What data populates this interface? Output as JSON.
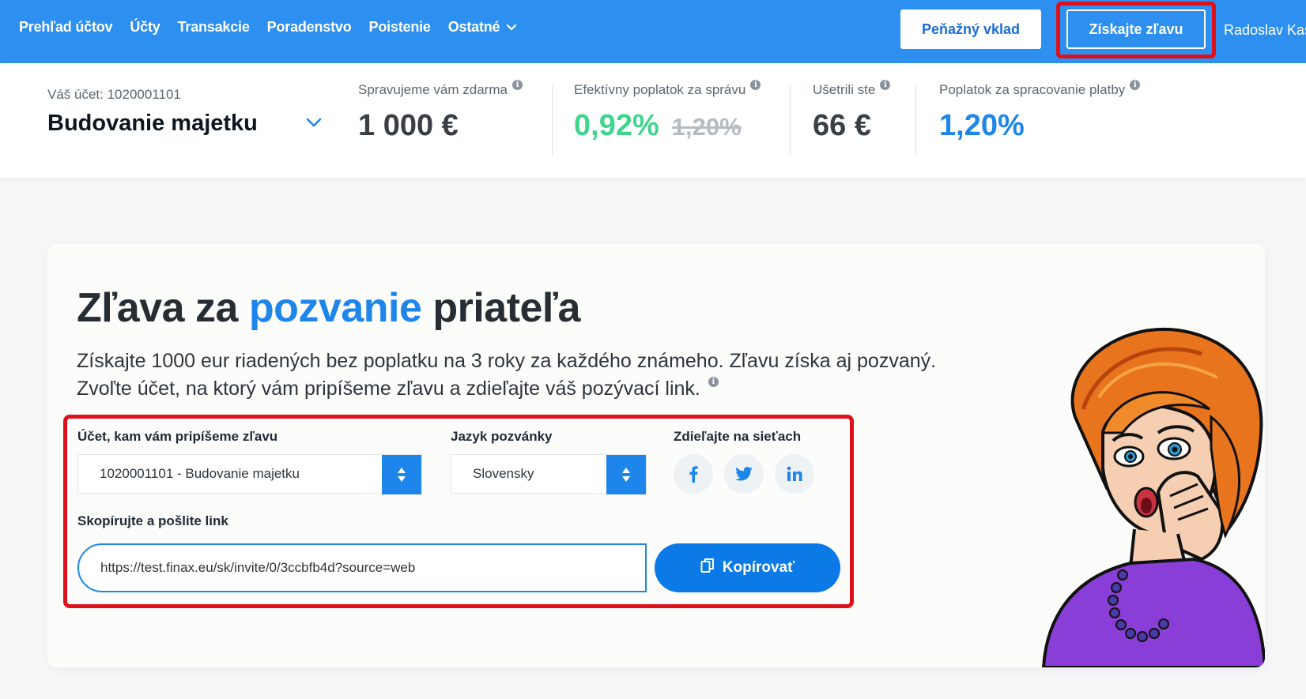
{
  "nav": {
    "items": [
      "Prehľad účtov",
      "Účty",
      "Transakcie",
      "Poradenstvo",
      "Poistenie",
      "Ostatné"
    ],
    "deposit_label": "Peňažný vklad",
    "discount_label": "Získajte zľavu",
    "user_name": "Radoslav Kas"
  },
  "summary": {
    "account_label": "Váš účet: 1020001101",
    "account_name": "Budovanie majetku",
    "managed_label": "Spravujeme vám zdarma",
    "managed_value": "1 000 €",
    "fee_label": "Efektívny poplatok za správu",
    "fee_value": "0,92%",
    "fee_old": "1,20%",
    "saved_label": "Ušetrili ste",
    "saved_value": "66 €",
    "payment_label": "Poplatok za spracovanie platby",
    "payment_value": "1,20%"
  },
  "card": {
    "title_part1": "Zľava za ",
    "title_highlight": "pozvanie",
    "title_part2": " priateľa",
    "description": "Získajte 1000 eur riadených bez poplatku na 3 roky za každého známeho. Zľavu získa aj pozvaný. Zvoľte účet, na ktorý vám pripíšeme zľavu a zdieľajte váš pozývací link.",
    "account_field_label": "Účet, kam vám pripíšeme zľavu",
    "account_field_value": "1020001101 - Budovanie majetku",
    "language_field_label": "Jazyk pozvánky",
    "language_field_value": "Slovensky",
    "share_label": "Zdieľajte na sieťach",
    "copy_label": "Skopírujte a pošlite link",
    "invite_link": "https://test.finax.eu/sk/invite/0/3ccbfb4d?source=web",
    "copy_button": "Kopírovať"
  },
  "colors": {
    "nav_blue": "#2d8fef",
    "accent_blue": "#1e86ea",
    "green": "#3fd58f",
    "highlight_red": "#e0101a"
  },
  "icons": [
    "chevron-down-icon",
    "info-icon",
    "facebook-icon",
    "twitter-icon",
    "linkedin-icon",
    "copy-icon",
    "sort-arrows-icon"
  ]
}
